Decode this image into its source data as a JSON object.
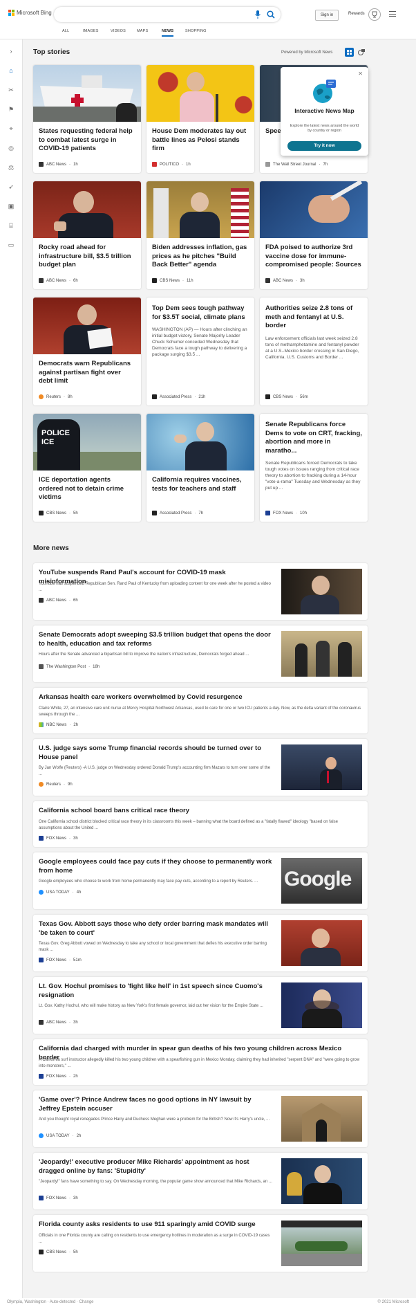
{
  "brand": {
    "name": "Microsoft Bing"
  },
  "header": {
    "signin": "Sign in",
    "rewards": "Rewards"
  },
  "nav": [
    "ALL",
    "IMAGES",
    "VIDEOS",
    "MAPS",
    "NEWS",
    "SHOPPING"
  ],
  "nav_active": "NEWS",
  "top_stories": {
    "heading": "Top stories",
    "powered": "Powered by Microsoft News",
    "cards": [
      {
        "title": "States requesting federal help to combat latest surge in COVID-19 patients",
        "source": "ABC News",
        "time": "1h"
      },
      {
        "title": "House Dem moderates lay out battle lines as Pelosi stands firm",
        "source": "POLITICO",
        "time": "1h"
      },
      {
        "title": "Speech… Surp… Dism…",
        "source": "The Wall Street Journal",
        "time": "7h"
      },
      {
        "title": "Rocky road ahead for infrastructure bill, $3.5 trillion budget plan",
        "source": "ABC News",
        "time": "6h"
      },
      {
        "title": "Biden addresses inflation, gas prices as he pitches \"Build Back Better\" agenda",
        "source": "CBS News",
        "time": "11h"
      },
      {
        "title": "FDA poised to authorize 3rd vaccine dose for immune-compromised people: Sources",
        "source": "ABC News",
        "time": "3h"
      },
      {
        "title": "Democrats warn Republicans against partisan fight over debt limit",
        "source": "Reuters",
        "time": "8h"
      },
      {
        "title": "Top Dem sees tough pathway for $3.5T social, climate plans",
        "snippet": "WASHINGTON (AP) — Hours after clinching an initial budget victory, Senate Majority Leader Chuck Schumer conceded Wednesday that Democrats face a tough pathway to delivering a package surging $3.5 ...",
        "source": "Associated Press",
        "time": "21h"
      },
      {
        "title": "Authorities seize 2.8 tons of meth and fentanyl at U.S. border",
        "snippet": "Law enforcement officials last week seized 2.8 tons of methamphetamine and fentanyl powder at a U.S.-Mexico border crossing in San Diego, California. U.S. Customs and Border ...",
        "source": "CBS News",
        "time": "56m"
      },
      {
        "title": "ICE deportation agents ordered not to detain crime victims",
        "source": "CBS News",
        "time": "5h"
      },
      {
        "title": "California requires vaccines, tests for teachers and staff",
        "source": "Associated Press",
        "time": "7h"
      },
      {
        "title": "Senate Republicans force Dems to vote on CRT, fracking, abortion and more in maratho...",
        "snippet": "Senate Republicans forced Democrats to take tough votes on issues ranging from critical race theory to abortion to fracking during a 14-hour \"vote-a-rama\" Tuesday and Wednesday as they put up ...",
        "source": "FOX News",
        "time": "10h"
      }
    ]
  },
  "popup": {
    "title": "Interactive News Map",
    "subtitle": "Explore the latest news around the world by country or region",
    "button": "Try it now"
  },
  "more_news": {
    "heading": "More news",
    "items": [
      {
        "title": "YouTube suspends Rand Paul's account for COVID-19 mask misinformation",
        "snippet": "YouTube has suspended Republican Sen. Rand Paul of Kentucky from uploading content for one week after he posted a video ...",
        "source": "ABC News",
        "time": "6h"
      },
      {
        "title": "Senate Democrats adopt sweeping $3.5 trillion budget that opens the door to health, education and tax reforms",
        "snippet": "Hours after the Senate advanced a bipartisan bill to improve the nation's infrastructure, Democrats forged ahead ...",
        "source": "The Washington Post",
        "time": "18h"
      },
      {
        "title": "Arkansas health care workers overwhelmed by Covid resurgence",
        "snippet": "Claire White, 27, an intensive care unit nurse at Mercy Hospital Northwest Arkansas, used to care for one or two ICU patients a day. Now, as the delta variant of the coronavirus sweeps through the ...",
        "source": "NBC News",
        "time": "2h"
      },
      {
        "title": "U.S. judge says some Trump financial records should be turned over to House panel",
        "snippet": "By Jan Wolfe (Reuters) -A U.S. judge on Wednesday ordered Donald Trump's accounting firm Mazars to turn over some of the ...",
        "source": "Reuters",
        "time": "9h"
      },
      {
        "title": "California school board bans critical race theory",
        "snippet": "One California school district blocked critical race theory in its classrooms this week – banning what the board defined as a \"fatally flawed\" ideology \"based on false assumptions about the United ...",
        "source": "FOX News",
        "time": "3h"
      },
      {
        "title": "Google employees could face pay cuts if they choose to permanently work from home",
        "snippet": "Google employees who choose to work from home permanently may face pay cuts, according to a report by Reuters. ...",
        "source": "USA TODAY",
        "time": "4h"
      },
      {
        "title": "Texas Gov. Abbott says those who defy order barring mask mandates will 'be taken to court'",
        "snippet": "Texas Gov. Greg Abbott vowed on Wednesday to take any school or local government that defies his executive order barring mask ...",
        "source": "FOX News",
        "time": "51m"
      },
      {
        "title": "Lt. Gov. Hochul promises to 'fight like hell' in 1st speech since Cuomo's resignation",
        "snippet": "Lt. Gov. Kathy Hochul, who will make history as New York's first female governor, laid out her vision for the Empire State ...",
        "source": "ABC News",
        "time": "3h"
      },
      {
        "title": "California dad charged with murder in spear gun deaths of his two young children across Mexico border",
        "snippet": "A California surf instructor allegedly killed his two young children with a spearfishing gun in Mexico Monday, claiming they had inherited \"serpent DNA\" and \"were going to grow into monsters,\" ...",
        "source": "FOX News",
        "time": "2h"
      },
      {
        "title": "'Game over'? Prince Andrew faces no good options in NY lawsuit by Jeffrey Epstein accuser",
        "snippet": "And you thought royal renegades Prince Harry and Duchess Meghan were a problem for the British? Now it's Harry's uncle, ...",
        "source": "USA TODAY",
        "time": "2h"
      },
      {
        "title": "'Jeopardy!' executive producer Mike Richards' appointment as host dragged online by fans: 'Stupidity'",
        "snippet": "\"Jeopardy!\" fans have something to say. On Wednesday morning, the popular game show announced that Mike Richards, an ...",
        "source": "FOX News",
        "time": "3h"
      },
      {
        "title": "Florida county asks residents to use 911 sparingly amid COVID surge",
        "snippet": "Officials in one Florida county are calling on residents to use emergency hotlines in moderation as a surge in COVID-19 cases ...",
        "source": "CBS News",
        "time": "5h"
      }
    ]
  },
  "footer": {
    "location": "Olympia, Washington · Auto-detected · Change",
    "copyright": "© 2021 Microsoft"
  },
  "colors": {
    "accent": "#0a6bc1",
    "popup_button": "#0e7490"
  }
}
